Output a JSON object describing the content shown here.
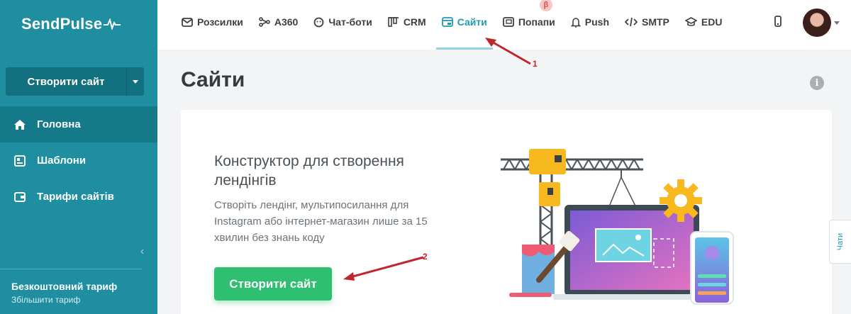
{
  "brand": {
    "name": "SendPulse"
  },
  "sidebar": {
    "create_button": "Створити сайт",
    "items": [
      {
        "label": "Головна",
        "icon": "home-icon",
        "active": true
      },
      {
        "label": "Шаблони",
        "icon": "templates-icon",
        "active": false
      },
      {
        "label": "Тарифи сайтів",
        "icon": "wallet-icon",
        "active": false
      }
    ],
    "plan": {
      "title": "Безкоштовний тариф",
      "upgrade": "Збільшити тариф"
    }
  },
  "topnav": {
    "tabs": [
      {
        "label": "Розсилки",
        "icon": "mail-icon"
      },
      {
        "label": "A360",
        "icon": "flow-icon"
      },
      {
        "label": "Чат-боти",
        "icon": "chatbot-icon"
      },
      {
        "label": "CRM",
        "icon": "crm-icon"
      },
      {
        "label": "Сайти",
        "icon": "site-icon",
        "active": true
      },
      {
        "label": "Попапи",
        "icon": "popup-icon",
        "badge": "β"
      },
      {
        "label": "Push",
        "icon": "bell-icon"
      },
      {
        "label": "SMTP",
        "icon": "code-icon"
      },
      {
        "label": "EDU",
        "icon": "graduation-icon"
      }
    ]
  },
  "main": {
    "title": "Сайти",
    "card": {
      "title": "Конструктор для створення лендінгів",
      "description": "Створіть лендінг, мультипосилання для Instagram або інтернет-магазин лише за 15 хвилин без знань коду",
      "cta": "Створити сайт"
    }
  },
  "chat_tab": "Чати",
  "annotations": {
    "first": "1",
    "second": "2"
  },
  "colors": {
    "sidebar": "#1e8ea0",
    "accent": "#1e9bb0",
    "cta": "#2fbf71",
    "arrow": "#c0272d"
  }
}
